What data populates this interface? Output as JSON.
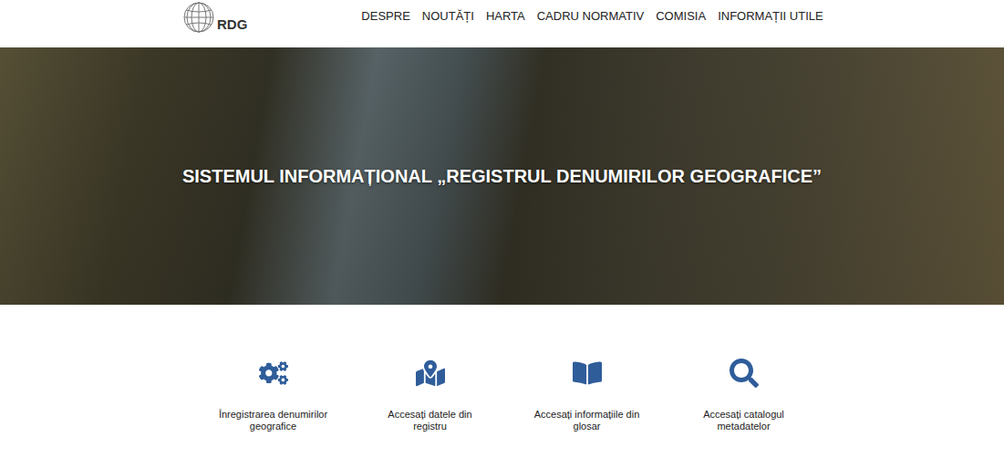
{
  "logo": {
    "text": "RDG"
  },
  "nav": [
    {
      "label": "DESPRE"
    },
    {
      "label": "NOUTĂȚI"
    },
    {
      "label": "HARTA"
    },
    {
      "label": "CADRU NORMATIV"
    },
    {
      "label": "COMISIA"
    },
    {
      "label": "INFORMAȚII UTILE"
    }
  ],
  "hero": {
    "title": "SISTEMUL INFORMAȚIONAL „REGISTRUL DENUMIRILOR GEOGRAFICE”"
  },
  "features": [
    {
      "label": "Înregistrarea denumirilor geografice"
    },
    {
      "label": "Accesați datele din registru"
    },
    {
      "label": "Accesați informațiile din glosar"
    },
    {
      "label": "Accesați catalogul metadatelor"
    }
  ]
}
